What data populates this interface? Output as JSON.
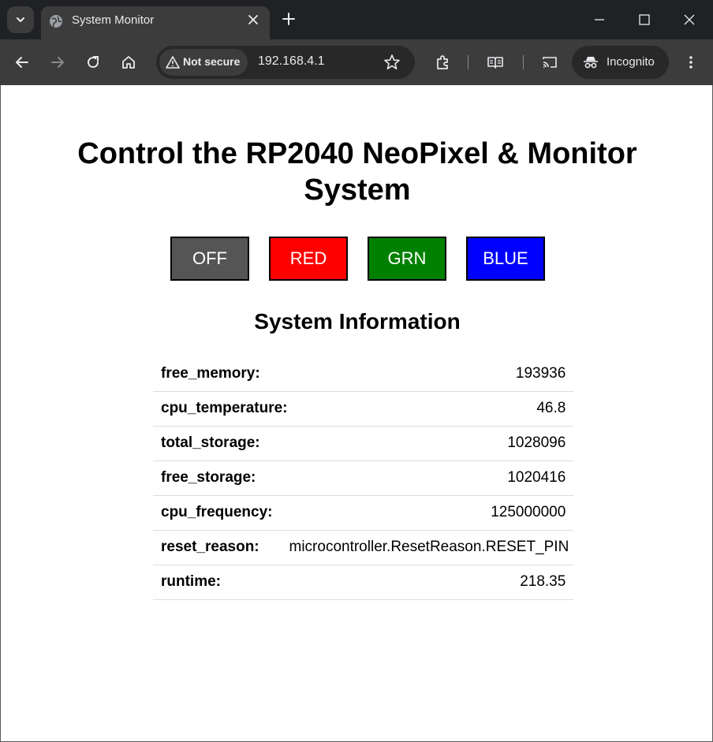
{
  "browser": {
    "tab_title": "System Monitor",
    "security_label": "Not secure",
    "url": "192.168.4.1",
    "profile_label": "Incognito",
    "icons": [
      "tab-search-icon",
      "globe-icon",
      "close-icon",
      "plus-icon",
      "minimize-icon",
      "maximize-icon",
      "close-window-icon",
      "back-icon",
      "forward-icon",
      "reload-icon",
      "home-icon",
      "warning-icon",
      "star-icon",
      "extensions-icon",
      "reading-mode-icon",
      "cast-icon",
      "incognito-icon",
      "more-icon"
    ]
  },
  "page": {
    "title": "Control the RP2040 NeoPixel & Monitor System",
    "buttons": [
      {
        "label": "OFF",
        "color": "#555555"
      },
      {
        "label": "RED",
        "color": "#ff0000"
      },
      {
        "label": "GRN",
        "color": "#008000"
      },
      {
        "label": "BLUE",
        "color": "#0000ff"
      }
    ],
    "section_title": "System Information",
    "info": [
      {
        "key": "free_memory:",
        "value": "193936"
      },
      {
        "key": "cpu_temperature:",
        "value": "46.8"
      },
      {
        "key": "total_storage:",
        "value": "1028096"
      },
      {
        "key": "free_storage:",
        "value": "1020416"
      },
      {
        "key": "cpu_frequency:",
        "value": "125000000"
      },
      {
        "key": "reset_reason:",
        "value": "microcontroller.ResetReason.RESET_PIN"
      },
      {
        "key": "runtime:",
        "value": "218.35"
      }
    ]
  }
}
